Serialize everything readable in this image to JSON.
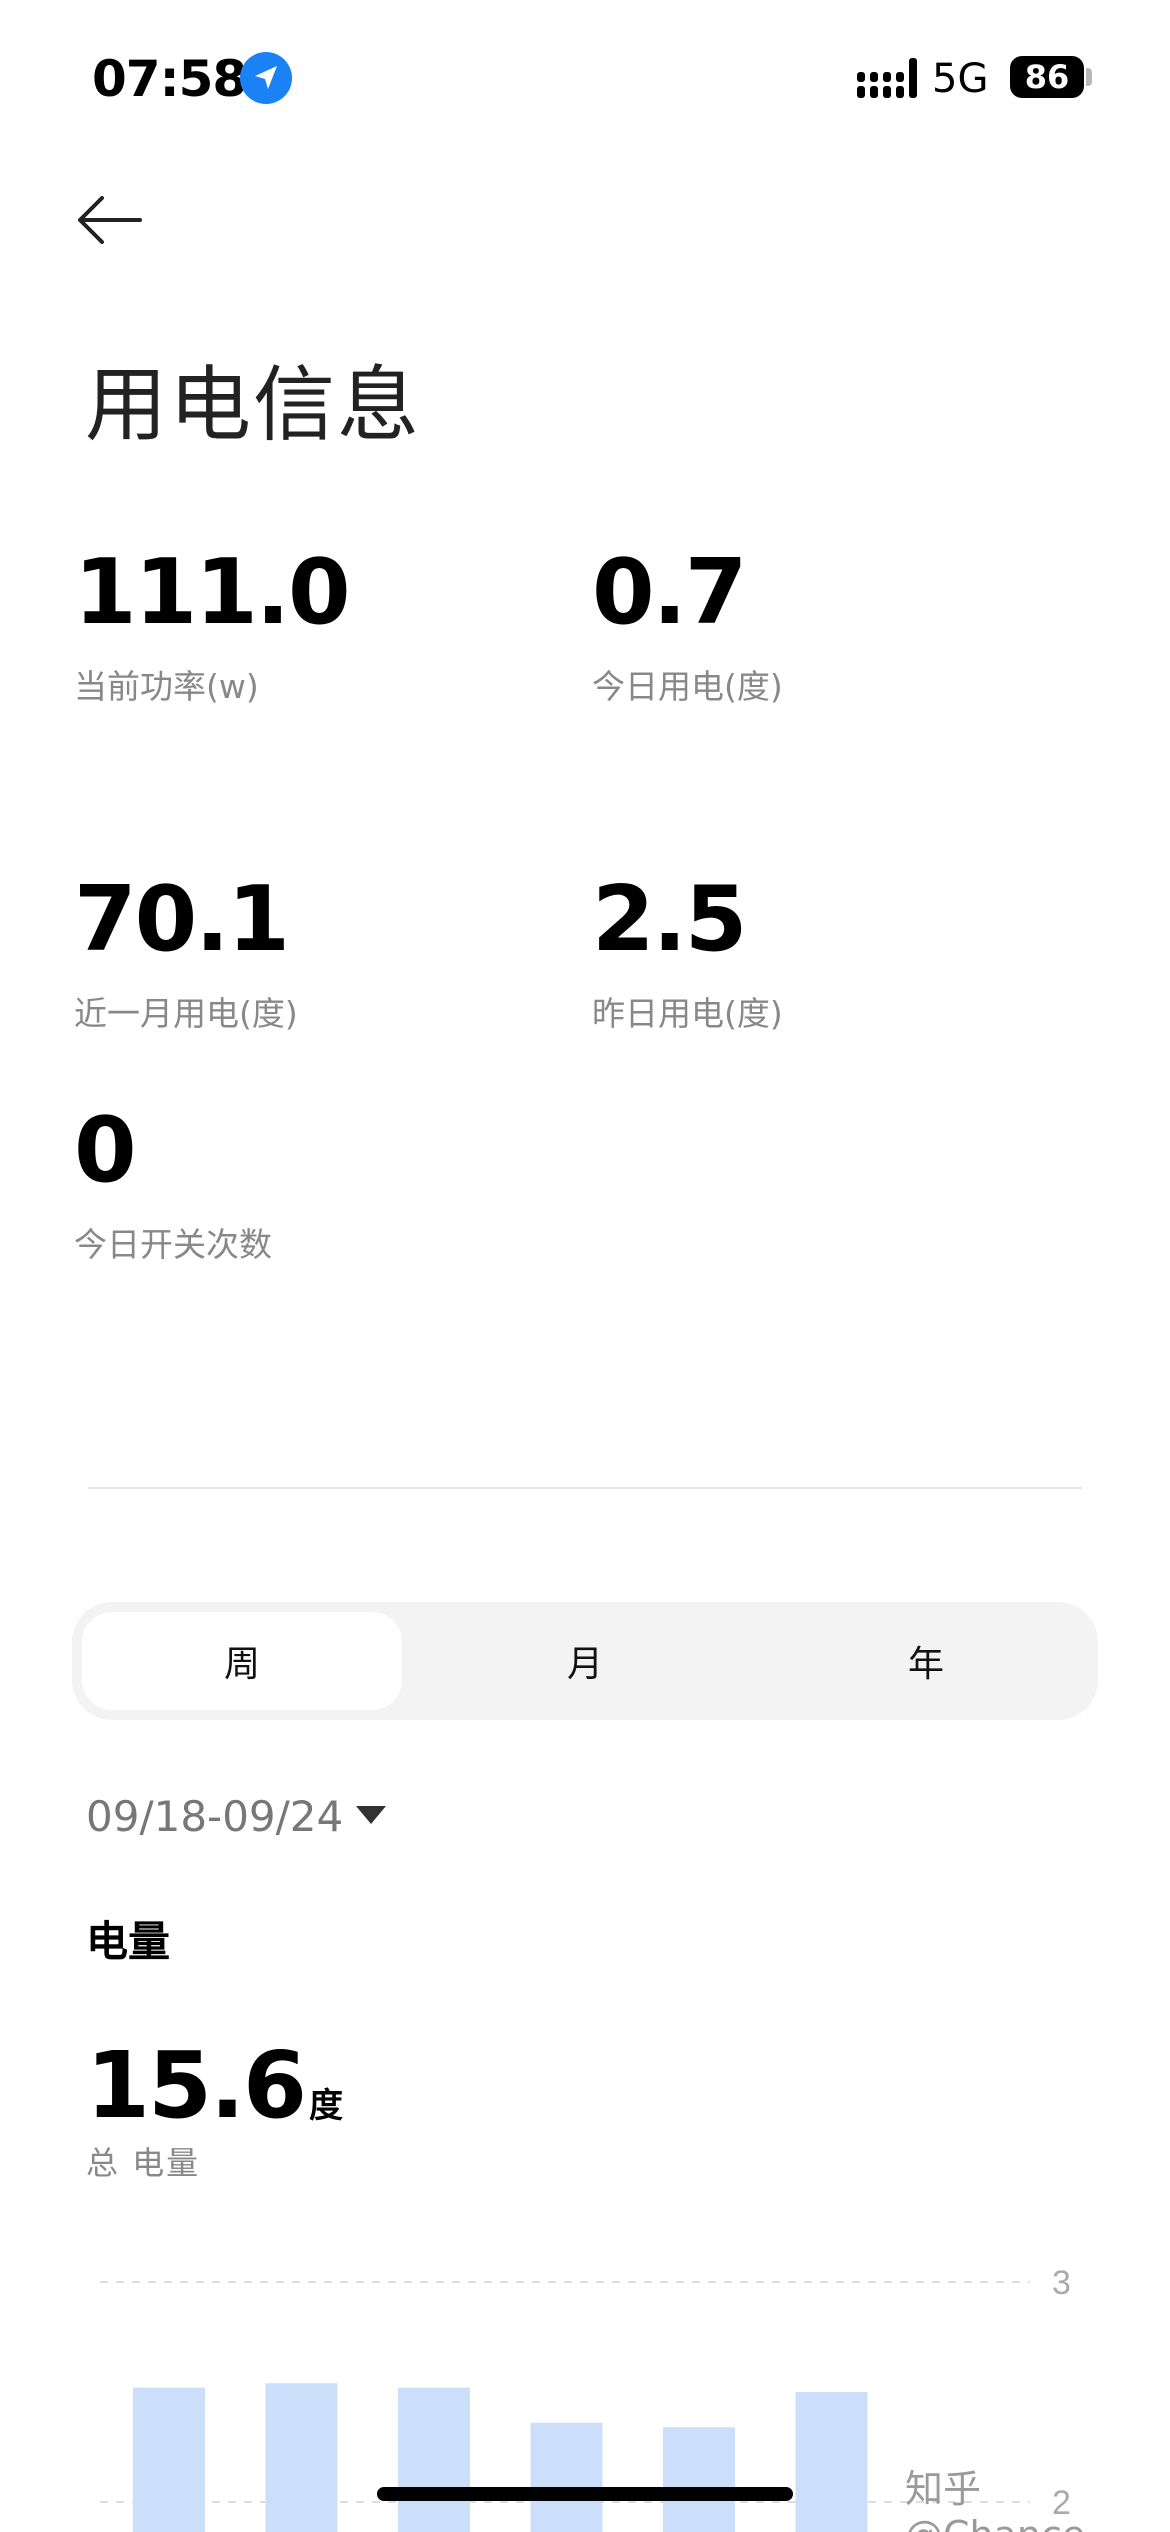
{
  "status_bar": {
    "time": "07:58",
    "network": "5G",
    "battery": "86"
  },
  "title": "用电信息",
  "stats": [
    {
      "value": "111.0",
      "label": "当前功率(w)"
    },
    {
      "value": "0.7",
      "label": "今日用电(度)"
    },
    {
      "value": "70.1",
      "label": "近一月用电(度)"
    },
    {
      "value": "2.5",
      "label": "昨日用电(度)"
    },
    {
      "value": "0",
      "label": "今日开关次数"
    }
  ],
  "tabs": [
    {
      "label": "周",
      "active": true
    },
    {
      "label": "月",
      "active": false
    },
    {
      "label": "年",
      "active": false
    }
  ],
  "date_range": "09/18-09/24",
  "section_title": "电量",
  "total": {
    "value": "15.6",
    "unit": "度",
    "label": "总 电量"
  },
  "watermark": "知乎 @Chance",
  "chart_data": {
    "type": "bar",
    "values": [
      2.52,
      2.54,
      2.52,
      2.36,
      2.34,
      2.5
    ],
    "ylim": [
      2,
      3
    ],
    "yticks": [
      "3",
      "2"
    ],
    "color": "#ccdffa",
    "grid": true
  }
}
